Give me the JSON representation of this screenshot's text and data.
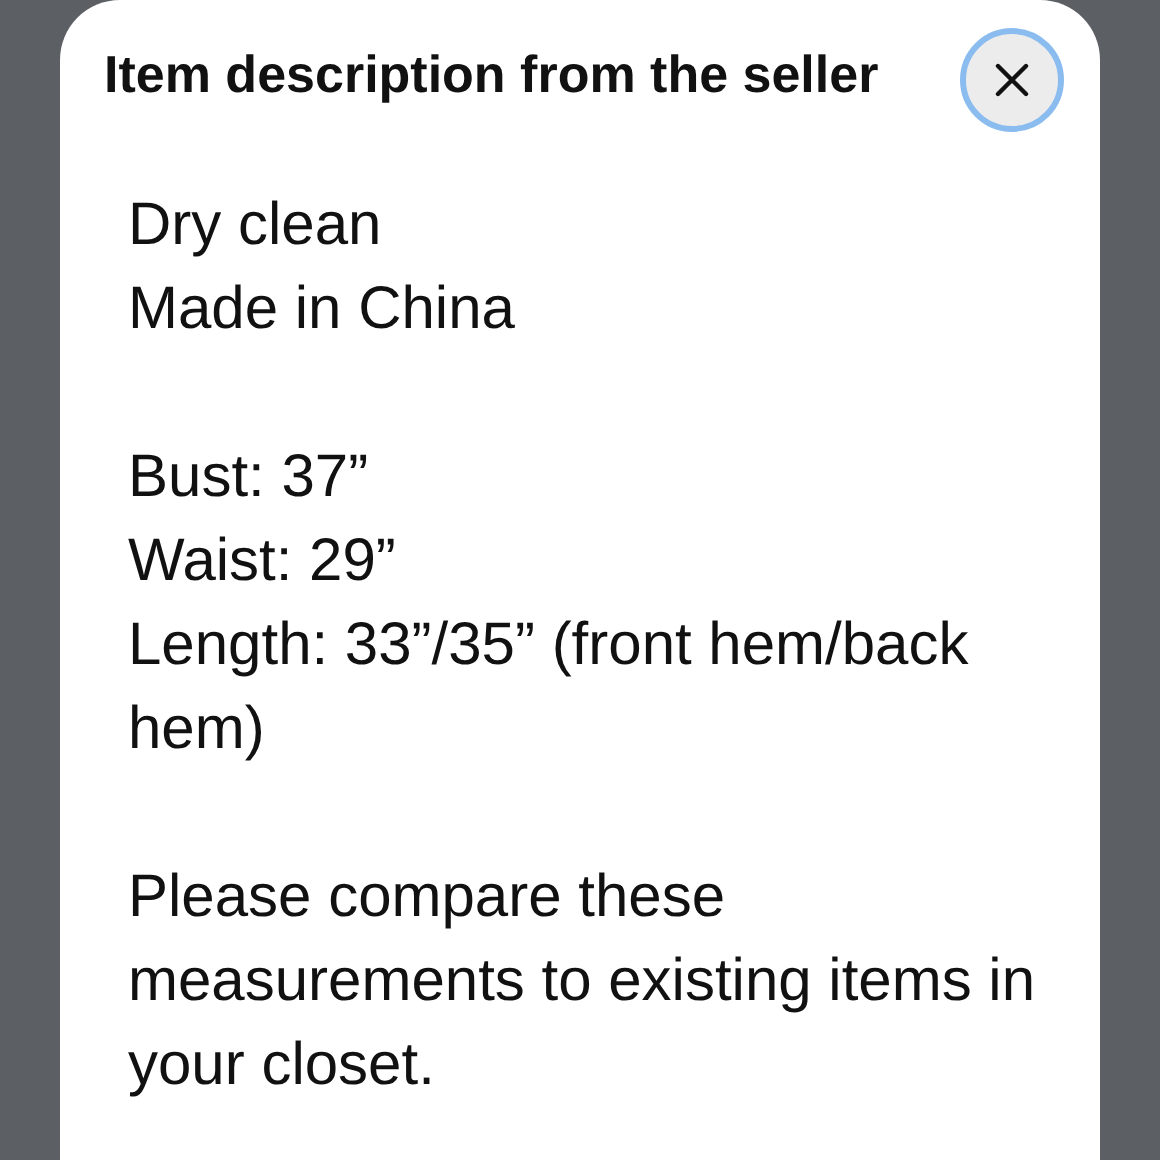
{
  "modal": {
    "title": "Item description from the seller",
    "paragraphs": [
      {
        "lines": [
          "Dry clean",
          "Made in China"
        ]
      },
      {
        "lines": [
          "Bust: 37”",
          "Waist: 29”",
          "Length: 33”/35” (front hem/back hem)"
        ]
      },
      {
        "lines": [
          "Please compare these measurements to existing items in your closet."
        ]
      }
    ]
  }
}
